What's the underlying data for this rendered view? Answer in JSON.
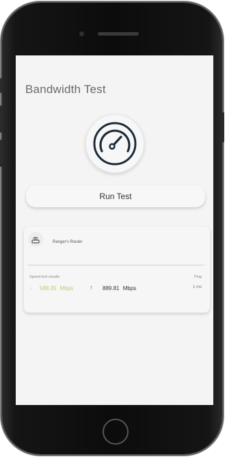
{
  "app": {
    "title": "Bandwidth Test"
  },
  "actions": {
    "run_test_label": "Run Test"
  },
  "router": {
    "name": "Ranger's Router",
    "icon": "router-icon"
  },
  "results": {
    "label": "Speed test results",
    "download_value": "588.35",
    "download_unit": "Mbps",
    "upload_value": "889.81",
    "upload_unit": "Mbps",
    "ping_label": "Ping",
    "ping_value": "1 ms"
  },
  "icons": {
    "gauge": "speedometer-icon",
    "download": "arrow-down-icon",
    "upload": "arrow-up-icon"
  },
  "colors": {
    "accent_dark": "#1c2b3a",
    "download_color": "#c2c96e",
    "screen_bg": "#f4f4f4"
  }
}
